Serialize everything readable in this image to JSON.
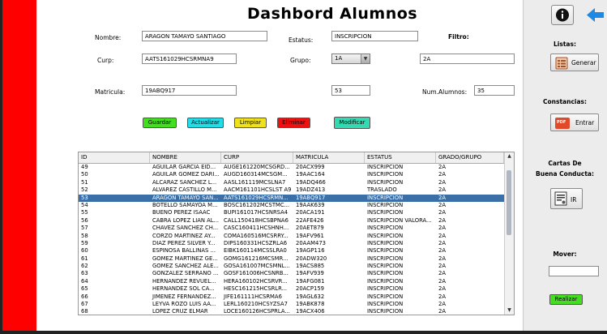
{
  "title": "Dashbord Alumnos",
  "form": {
    "nombre_label": "Nombre:",
    "nombre_value": "ARAGON TAMAYO SANTIAGO",
    "estatus_label": "Estatus:",
    "estatus_value": "INSCRIPCION",
    "filtro_label": "Filtro:",
    "curp_label": "Curp:",
    "curp_value": "AATS161029HCSRMNA9",
    "grupo_label": "Grupo:",
    "grupo_value": "1A",
    "filtro_value": "2A",
    "matricula_label": "Matricula:",
    "matricula_value": "19ABQ917",
    "num_value": "53",
    "num_alumnos_label": "Num.Alumnos:",
    "num_alumnos_value": "35"
  },
  "buttons": {
    "guardar": "Guardar",
    "actualizar": "Actualizar",
    "limpiar": "Limpiar",
    "eliminar": "Eliminar",
    "modificar": "Modificar"
  },
  "colors": {
    "guardar": "#44dd22",
    "actualizar": "#22dde8",
    "limpiar": "#f0e21a",
    "eliminar": "#ee1111",
    "modificar": "#33d9b0",
    "sidebar": "#ff0000",
    "selected_row": "#3a6fa8"
  },
  "table": {
    "headers": [
      "ID",
      "NOMBRE",
      "CURP",
      "MATRICULA",
      "ESTATUS",
      "GRADO/GRUPO"
    ],
    "rows": [
      [
        "49",
        "AGUILAR GARCIA EID...",
        "AUGE161220MCSGRD...",
        "20ACX999",
        "INSCRIPCION",
        "2A"
      ],
      [
        "50",
        "AGUILAR GOMEZ DARI...",
        "AUGD160314MCSGM...",
        "19AAC164",
        "INSCRIPCION",
        "2A"
      ],
      [
        "51",
        "ALCARAZ SANCHEZ L...",
        "AASL161119MCSLNA7",
        "19ADQ466",
        "INSCRIPCION",
        "2A"
      ],
      [
        "52",
        "ALVAREZ CASTILLO M...",
        "AACM161101HCSLST A9",
        "19ADZ413",
        "TRASLADO",
        "2A"
      ],
      [
        "53",
        "ARAGON TAMAYO SAN...",
        "AATS161029HCSRMN...",
        "19ABQ917",
        "INSCRIPCION",
        "2A"
      ],
      [
        "54",
        "BOTELLO SAMAYOA M...",
        "BOSC161202MCSTMC...",
        "19AAK639",
        "INSCRIPCION",
        "2A"
      ],
      [
        "55",
        "BUENO PEREZ ISAAC",
        "BUPI161017HCSNRSA4",
        "20ACA191",
        "INSCRIPCION",
        "2A"
      ],
      [
        "56",
        "CABRA LOPEZ LIAN AL...",
        "CALL150418HCSBPNA6",
        "22AFE426",
        "INSCRIPCION VALORA...",
        "2A"
      ],
      [
        "57",
        "CHAVEZ SANCHEZ CH...",
        "CASC160411HCSHNH...",
        "20AET879",
        "INSCRIPCION",
        "2A"
      ],
      [
        "58",
        "CORZO MARTINEZ AY...",
        "COMA160516MCSRRY...",
        "19AFV961",
        "INSCRIPCION",
        "2A"
      ],
      [
        "59",
        "DIAZ PEREZ SILVER Y...",
        "DIPS160331HCSZRLA6",
        "20AAM473",
        "INSCRIPCION",
        "2A"
      ],
      [
        "60",
        "ESPINOSA BALLINAS ...",
        "EIBK160114MCSSLRA0",
        "19AGP116",
        "INSCRIPCION",
        "2A"
      ],
      [
        "61",
        "GOMEZ MARTINEZ GE...",
        "GOMG161216MCSMR...",
        "20ADW320",
        "INSCRIPCION",
        "2A"
      ],
      [
        "62",
        "GOMEZ SANCHEZ ALE...",
        "GOSA161007MCSMNL...",
        "19ACS885",
        "INSCRIPCION",
        "2A"
      ],
      [
        "63",
        "GONZALEZ SERRANO ...",
        "GOSF161006HCSNRB...",
        "19AFV939",
        "INSCRIPCION",
        "2A"
      ],
      [
        "64",
        "HERNANDEZ REVUEL...",
        "HERA160102HCSRVR...",
        "19AFG081",
        "INSCRIPCION",
        "2A"
      ],
      [
        "65",
        "HERNANDEZ SOL CA...",
        "HESC161215HCSRLR...",
        "20ACP159",
        "INSCRIPCION",
        "2A"
      ],
      [
        "66",
        "JIMENEZ FERNANDEZ...",
        "JIFE161111HCSRMA6",
        "19AGL632",
        "INSCRIPCION",
        "2A"
      ],
      [
        "67",
        "LEYVA ROZO LUIS AA...",
        "LERL160210HCSYZSA7",
        "19ABK878",
        "INSCRIPCION",
        "2A"
      ],
      [
        "68",
        "LOPEZ CRUZ ELMAR",
        "LOCE160126HCSPRLA...",
        "19ACX406",
        "INSCRIPCION",
        "2A"
      ]
    ],
    "selected_index": 4
  },
  "right": {
    "info_icon": "info-icon",
    "back_icon": "back-arrow-icon",
    "listas_label": "Listas:",
    "generar_label": "Generar",
    "constancias_label": "Constancias:",
    "entrar_label": "Entrar",
    "pdf_badge": "PDF",
    "cartas_label_1": "Cartas De",
    "cartas_label_2": "Buena Conducta:",
    "ir_label": "IR",
    "mover_label": "Mover:",
    "mover_value": "",
    "realizar_label": "Realizar"
  }
}
